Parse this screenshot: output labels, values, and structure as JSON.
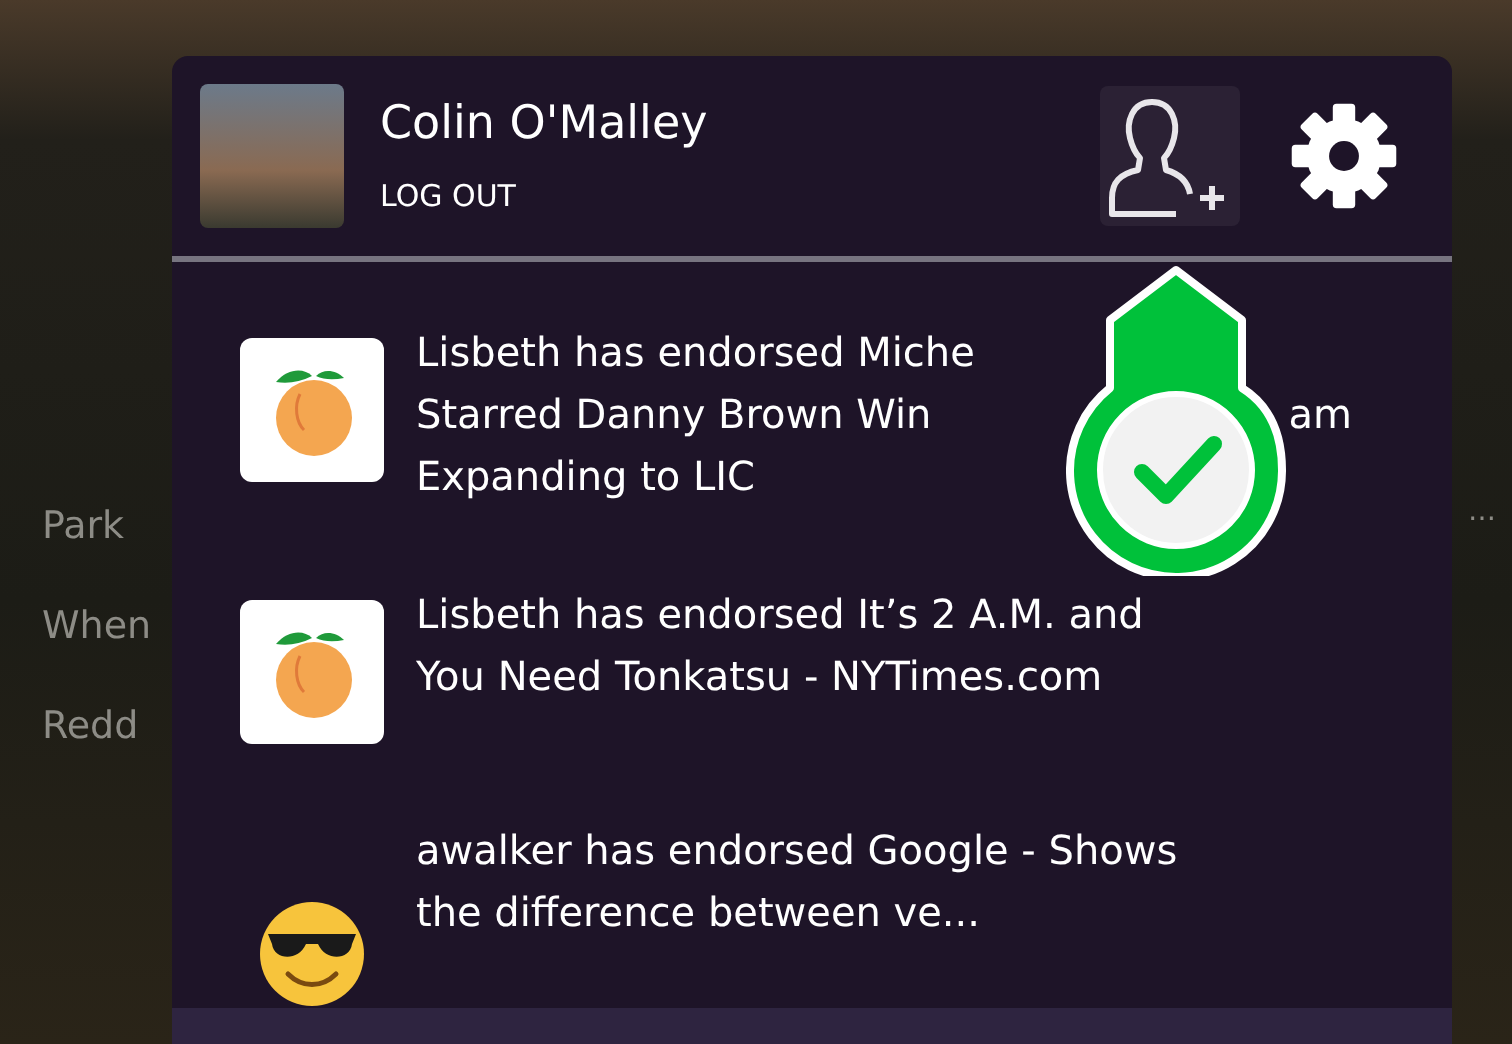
{
  "background_list": {
    "items": [
      "Park",
      "When",
      "Redd"
    ],
    "overflow": "…"
  },
  "user": {
    "name": "Colin O'Malley",
    "logout": "LOG OUT"
  },
  "notifications": [
    {
      "kind": "peach",
      "lines": [
        [
          "Lisbeth has endorsed Miche"
        ],
        [
          "Starred Danny Brown Win",
          "am"
        ],
        [
          "Expanding to LIC"
        ]
      ]
    },
    {
      "kind": "peach",
      "lines": [
        [
          "Lisbeth has endorsed It’s 2 A.M. and"
        ],
        [
          "You Need Tonkatsu - NYTimes.com"
        ]
      ]
    },
    {
      "kind": "sunglasses",
      "lines": [
        [
          "awalker has endorsed Google - Shows"
        ],
        [
          "the difference between ve..."
        ]
      ]
    }
  ]
}
